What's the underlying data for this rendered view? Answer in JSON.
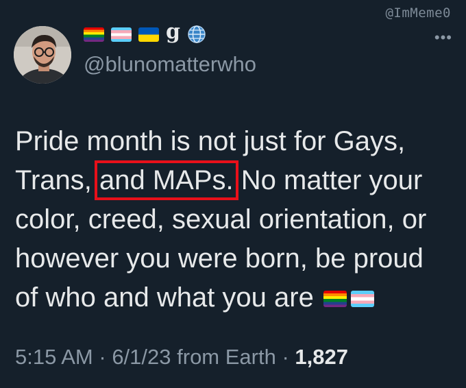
{
  "watermark": "@ImMeme0",
  "user": {
    "name_suffix": "g",
    "handle": "@blunomatterwho",
    "name_flags": [
      "pride-flag-icon",
      "trans-flag-icon",
      "ukraine-flag-icon"
    ]
  },
  "tweet": {
    "text_before_highlight": "Pride month is not just for Gays, Trans, ",
    "highlighted": "and MAPs.",
    "text_after_highlight": " No matter your color, creed, sexual orientation, or however you were born, be proud of who and what you are",
    "trailing_flags": [
      "pride-flag-icon",
      "trans-flag-icon"
    ]
  },
  "meta": {
    "time": "5:15 AM",
    "sep1": " · ",
    "date": "6/1/23",
    "source": " from Earth",
    "sep2": " · ",
    "views": "1,827"
  },
  "colors": {
    "background": "#15202b",
    "text": "#e7e9ea",
    "secondary": "#8b98a5",
    "highlight_box": "#e8101a"
  }
}
